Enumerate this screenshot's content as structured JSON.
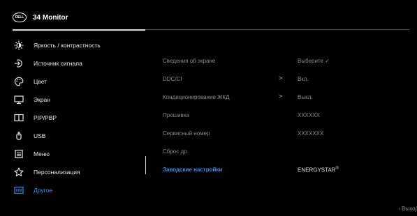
{
  "header": {
    "logo_text": "DELL",
    "title": "34 Monitor"
  },
  "menu": [
    {
      "label": "Яркость / контрастность",
      "icon": "brightness-icon"
    },
    {
      "label": "Источник сигнала",
      "icon": "input-source-icon"
    },
    {
      "label": "Цвет",
      "icon": "color-palette-icon"
    },
    {
      "label": "Экран",
      "icon": "display-monitor-icon"
    },
    {
      "label": "PIP/PBP",
      "icon": "pip-pbp-icon"
    },
    {
      "label": "USB",
      "icon": "usb-icon"
    },
    {
      "label": "Меню",
      "icon": "menu-icon"
    },
    {
      "label": "Персонализация",
      "icon": "star-icon"
    },
    {
      "label": "Другое",
      "icon": "other-settings-icon",
      "active": true
    }
  ],
  "settings": [
    {
      "label": "Сведения об экране",
      "value": "Выберите ✓"
    },
    {
      "label": "DDC/CI",
      "arrow": ">",
      "value": "Вкл."
    },
    {
      "label": "Кондиционирование ЖКД",
      "arrow": ">",
      "value": "Выкл."
    },
    {
      "label": "Прошивка",
      "value": "XXXXXX"
    },
    {
      "label": "Сервисный номер",
      "value": "XXXXXXX"
    },
    {
      "label": "Сброс др.",
      "value": ""
    },
    {
      "label": "Заводские настройки",
      "value": "ENERGYSTAR",
      "value_sup": "®",
      "active": true
    }
  ],
  "footer": {
    "exit_label": "‹ Выход"
  },
  "colors": {
    "background": "#000000",
    "accent": "#3a8ee6",
    "text": "#e8e8e8",
    "dim_text": "#8a8a8a"
  }
}
